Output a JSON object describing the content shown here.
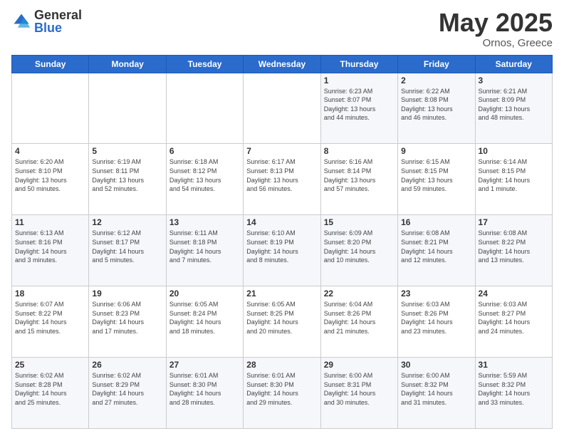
{
  "header": {
    "logo_general": "General",
    "logo_blue": "Blue",
    "title": "May 2025",
    "location": "Ornos, Greece"
  },
  "weekdays": [
    "Sunday",
    "Monday",
    "Tuesday",
    "Wednesday",
    "Thursday",
    "Friday",
    "Saturday"
  ],
  "weeks": [
    [
      {
        "day": "",
        "info": ""
      },
      {
        "day": "",
        "info": ""
      },
      {
        "day": "",
        "info": ""
      },
      {
        "day": "",
        "info": ""
      },
      {
        "day": "1",
        "info": "Sunrise: 6:23 AM\nSunset: 8:07 PM\nDaylight: 13 hours\nand 44 minutes."
      },
      {
        "day": "2",
        "info": "Sunrise: 6:22 AM\nSunset: 8:08 PM\nDaylight: 13 hours\nand 46 minutes."
      },
      {
        "day": "3",
        "info": "Sunrise: 6:21 AM\nSunset: 8:09 PM\nDaylight: 13 hours\nand 48 minutes."
      }
    ],
    [
      {
        "day": "4",
        "info": "Sunrise: 6:20 AM\nSunset: 8:10 PM\nDaylight: 13 hours\nand 50 minutes."
      },
      {
        "day": "5",
        "info": "Sunrise: 6:19 AM\nSunset: 8:11 PM\nDaylight: 13 hours\nand 52 minutes."
      },
      {
        "day": "6",
        "info": "Sunrise: 6:18 AM\nSunset: 8:12 PM\nDaylight: 13 hours\nand 54 minutes."
      },
      {
        "day": "7",
        "info": "Sunrise: 6:17 AM\nSunset: 8:13 PM\nDaylight: 13 hours\nand 56 minutes."
      },
      {
        "day": "8",
        "info": "Sunrise: 6:16 AM\nSunset: 8:14 PM\nDaylight: 13 hours\nand 57 minutes."
      },
      {
        "day": "9",
        "info": "Sunrise: 6:15 AM\nSunset: 8:15 PM\nDaylight: 13 hours\nand 59 minutes."
      },
      {
        "day": "10",
        "info": "Sunrise: 6:14 AM\nSunset: 8:15 PM\nDaylight: 14 hours\nand 1 minute."
      }
    ],
    [
      {
        "day": "11",
        "info": "Sunrise: 6:13 AM\nSunset: 8:16 PM\nDaylight: 14 hours\nand 3 minutes."
      },
      {
        "day": "12",
        "info": "Sunrise: 6:12 AM\nSunset: 8:17 PM\nDaylight: 14 hours\nand 5 minutes."
      },
      {
        "day": "13",
        "info": "Sunrise: 6:11 AM\nSunset: 8:18 PM\nDaylight: 14 hours\nand 7 minutes."
      },
      {
        "day": "14",
        "info": "Sunrise: 6:10 AM\nSunset: 8:19 PM\nDaylight: 14 hours\nand 8 minutes."
      },
      {
        "day": "15",
        "info": "Sunrise: 6:09 AM\nSunset: 8:20 PM\nDaylight: 14 hours\nand 10 minutes."
      },
      {
        "day": "16",
        "info": "Sunrise: 6:08 AM\nSunset: 8:21 PM\nDaylight: 14 hours\nand 12 minutes."
      },
      {
        "day": "17",
        "info": "Sunrise: 6:08 AM\nSunset: 8:22 PM\nDaylight: 14 hours\nand 13 minutes."
      }
    ],
    [
      {
        "day": "18",
        "info": "Sunrise: 6:07 AM\nSunset: 8:22 PM\nDaylight: 14 hours\nand 15 minutes."
      },
      {
        "day": "19",
        "info": "Sunrise: 6:06 AM\nSunset: 8:23 PM\nDaylight: 14 hours\nand 17 minutes."
      },
      {
        "day": "20",
        "info": "Sunrise: 6:05 AM\nSunset: 8:24 PM\nDaylight: 14 hours\nand 18 minutes."
      },
      {
        "day": "21",
        "info": "Sunrise: 6:05 AM\nSunset: 8:25 PM\nDaylight: 14 hours\nand 20 minutes."
      },
      {
        "day": "22",
        "info": "Sunrise: 6:04 AM\nSunset: 8:26 PM\nDaylight: 14 hours\nand 21 minutes."
      },
      {
        "day": "23",
        "info": "Sunrise: 6:03 AM\nSunset: 8:26 PM\nDaylight: 14 hours\nand 23 minutes."
      },
      {
        "day": "24",
        "info": "Sunrise: 6:03 AM\nSunset: 8:27 PM\nDaylight: 14 hours\nand 24 minutes."
      }
    ],
    [
      {
        "day": "25",
        "info": "Sunrise: 6:02 AM\nSunset: 8:28 PM\nDaylight: 14 hours\nand 25 minutes."
      },
      {
        "day": "26",
        "info": "Sunrise: 6:02 AM\nSunset: 8:29 PM\nDaylight: 14 hours\nand 27 minutes."
      },
      {
        "day": "27",
        "info": "Sunrise: 6:01 AM\nSunset: 8:30 PM\nDaylight: 14 hours\nand 28 minutes."
      },
      {
        "day": "28",
        "info": "Sunrise: 6:01 AM\nSunset: 8:30 PM\nDaylight: 14 hours\nand 29 minutes."
      },
      {
        "day": "29",
        "info": "Sunrise: 6:00 AM\nSunset: 8:31 PM\nDaylight: 14 hours\nand 30 minutes."
      },
      {
        "day": "30",
        "info": "Sunrise: 6:00 AM\nSunset: 8:32 PM\nDaylight: 14 hours\nand 31 minutes."
      },
      {
        "day": "31",
        "info": "Sunrise: 5:59 AM\nSunset: 8:32 PM\nDaylight: 14 hours\nand 33 minutes."
      }
    ]
  ]
}
